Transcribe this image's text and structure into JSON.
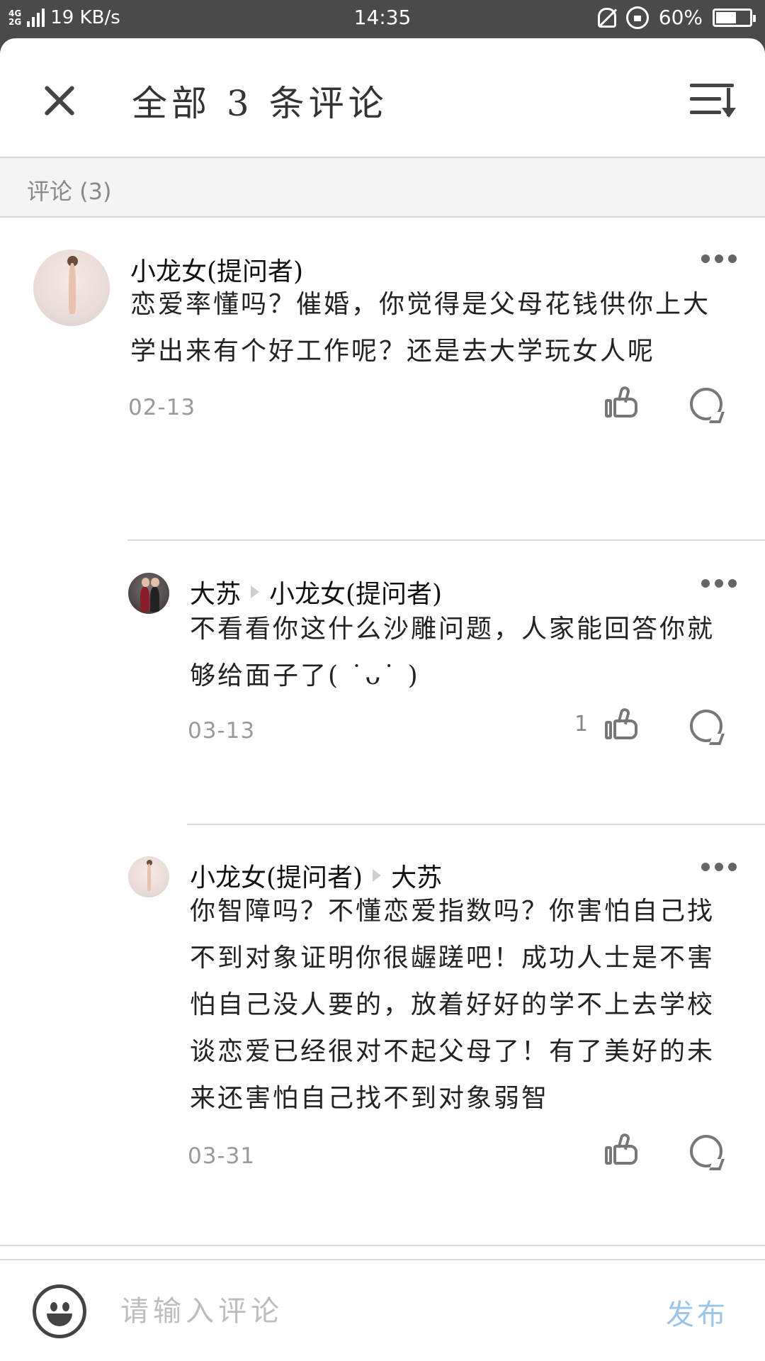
{
  "status_bar": {
    "network": "4G\n2G",
    "speed": "19 KB/s",
    "time": "14:35",
    "battery": "60%",
    "battery_level": 0.6
  },
  "header": {
    "title": "全部 3 条评论",
    "close_icon": "close-icon",
    "sort_icon": "sort-icon"
  },
  "section": {
    "label": "评论 (3)"
  },
  "comments": [
    {
      "author": "小龙女(提问者)",
      "reply_to": "",
      "text": "恋爱率懂吗？催婚，你觉得是父母花钱供你上大学出来有个好工作呢？还是去大学玩女人呢",
      "date": "02-13",
      "likes": ""
    },
    {
      "author": "大苏",
      "reply_to": "小龙女(提问者)",
      "text": "不看看你这什么沙雕问题，人家能回答你就够给面子了(  ˙ᴗ˙  )",
      "date": "03-13",
      "likes": "1"
    },
    {
      "author": "小龙女(提问者)",
      "reply_to": "大苏",
      "text": "你智障吗？不懂恋爱指数吗？你害怕自己找不到对象证明你很龌蹉吧！成功人士是不害怕自己没人要的，放着好好的学不上去学校谈恋爱已经很对不起父母了！有了美好的未来还害怕自己找不到对象弱智",
      "date": "03-31",
      "likes": ""
    }
  ],
  "input": {
    "placeholder": "请输入评论",
    "publish": "发布"
  },
  "colors": {
    "publish": "#9cc3e8",
    "status_bar_bg": "#4a4a4a"
  }
}
